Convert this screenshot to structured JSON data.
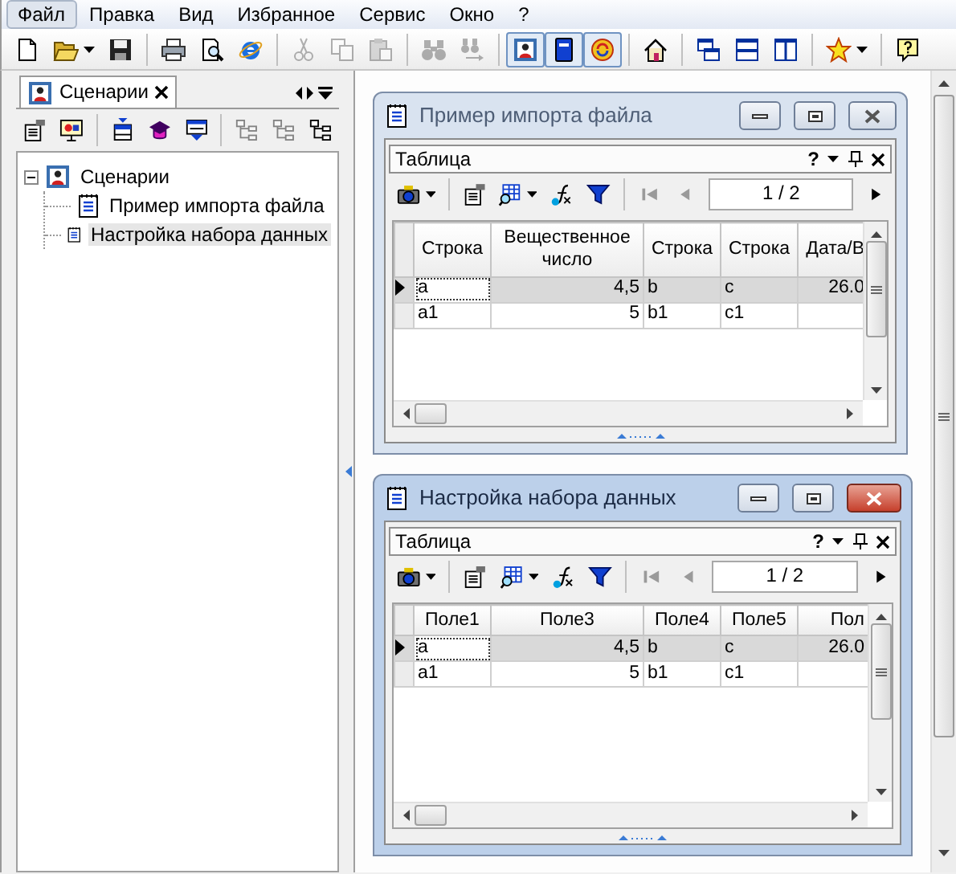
{
  "menu": [
    {
      "label": "Файл",
      "selected": true
    },
    {
      "label": "Правка",
      "selected": false
    },
    {
      "label": "Вид",
      "selected": false
    },
    {
      "label": "Избранное",
      "selected": false
    },
    {
      "label": "Сервис",
      "selected": false
    },
    {
      "label": "Окно",
      "selected": false
    },
    {
      "label": "?",
      "selected": false
    }
  ],
  "toolbar": {
    "groups": [
      {
        "buttons": [
          {
            "pressed": false,
            "disabled": false
          },
          {
            "pressed": false,
            "disabled": false,
            "dropdown": true
          },
          {
            "pressed": false,
            "disabled": false
          }
        ]
      },
      {
        "buttons": [
          {
            "pressed": false,
            "disabled": false
          },
          {
            "pressed": false,
            "disabled": false
          },
          {
            "pressed": false,
            "disabled": false
          }
        ]
      },
      {
        "buttons": [
          {
            "pressed": false,
            "disabled": true
          },
          {
            "pressed": false,
            "disabled": true
          },
          {
            "pressed": false,
            "disabled": true
          }
        ]
      },
      {
        "buttons": [
          {
            "pressed": false,
            "disabled": true
          },
          {
            "pressed": false,
            "disabled": true
          }
        ]
      },
      {
        "buttons": [
          {
            "pressed": true,
            "disabled": false
          },
          {
            "pressed": true,
            "disabled": false
          },
          {
            "pressed": true,
            "disabled": false
          }
        ]
      },
      {
        "buttons": [
          {
            "pressed": false,
            "disabled": false
          }
        ]
      },
      {
        "buttons": [
          {
            "pressed": false,
            "disabled": false
          },
          {
            "pressed": false,
            "disabled": false
          },
          {
            "pressed": false,
            "disabled": false
          }
        ]
      },
      {
        "buttons": [
          {
            "pressed": false,
            "disabled": false,
            "dropdown": true
          }
        ]
      },
      {
        "buttons": [
          {
            "pressed": false,
            "disabled": false
          }
        ]
      }
    ]
  },
  "side_panel": {
    "tab": {
      "label": "Сценарии",
      "selected": true
    },
    "toolbar": {
      "groups": [
        {
          "buttons": [
            {
              "disabled": false
            },
            {
              "disabled": false
            }
          ]
        },
        {
          "buttons": [
            {
              "disabled": false
            },
            {
              "disabled": false
            },
            {
              "disabled": false
            }
          ]
        },
        {
          "buttons": [
            {
              "disabled": true
            },
            {
              "disabled": true
            },
            {
              "disabled": false
            }
          ]
        }
      ]
    },
    "tree": [
      {
        "label": "Сценарии",
        "expanded": true,
        "selected": false,
        "children": [
          {
            "label": "Пример импорта файла",
            "selected": false
          },
          {
            "label": "Настройка набора данных",
            "selected": true
          }
        ]
      }
    ]
  },
  "windows": [
    {
      "title": "Пример импорта файла",
      "active": false,
      "panel": {
        "title": "Таблица",
        "help": "?"
      },
      "toolbar": {
        "groups": [
          {
            "buttons": [
              {
                "disabled": false,
                "dropdown": true
              }
            ]
          },
          {
            "buttons": [
              {
                "disabled": false
              },
              {
                "disabled": false,
                "dropdown": true
              },
              {
                "disabled": false
              },
              {
                "disabled": false
              }
            ]
          }
        ]
      },
      "pager": {
        "page": "1 / 2",
        "buttons": [
          {
            "disabled": true
          },
          {
            "disabled": true
          },
          {
            "disabled": false
          }
        ]
      },
      "columns": [
        {
          "label": "Строка",
          "kind": "text"
        },
        {
          "label": "Вещественное число",
          "kind": "number"
        },
        {
          "label": "Строка",
          "kind": "text"
        },
        {
          "label": "Строка",
          "kind": "text"
        },
        {
          "label": "Дата/В",
          "kind": "number"
        }
      ],
      "rows": [
        {
          "current": true,
          "selected": true,
          "cells": [
            {
              "text": "a",
              "focused": true
            },
            {
              "text": "4,5",
              "focused": false
            },
            {
              "text": "b",
              "focused": false
            },
            {
              "text": "c",
              "focused": false
            },
            {
              "text": "26.0",
              "focused": false
            }
          ]
        },
        {
          "current": false,
          "selected": false,
          "cells": [
            {
              "text": "a1",
              "focused": false
            },
            {
              "text": "5",
              "focused": false
            },
            {
              "text": "b1",
              "focused": false
            },
            {
              "text": "c1",
              "focused": false
            }
          ]
        }
      ]
    },
    {
      "title": "Настройка набора данных",
      "active": true,
      "panel": {
        "title": "Таблица",
        "help": "?"
      },
      "toolbar": {
        "groups": [
          {
            "buttons": [
              {
                "disabled": false,
                "dropdown": true
              }
            ]
          },
          {
            "buttons": [
              {
                "disabled": false
              },
              {
                "disabled": false,
                "dropdown": true
              },
              {
                "disabled": false
              },
              {
                "disabled": false
              }
            ]
          }
        ]
      },
      "pager": {
        "page": "1 / 2",
        "buttons": [
          {
            "disabled": true
          },
          {
            "disabled": true
          },
          {
            "disabled": false
          }
        ]
      },
      "columns": [
        {
          "label": "Поле1",
          "kind": "text"
        },
        {
          "label": "Поле3",
          "kind": "number"
        },
        {
          "label": "Поле4",
          "kind": "text"
        },
        {
          "label": "Поле5",
          "kind": "text"
        },
        {
          "label": "Пол",
          "kind": "number"
        }
      ],
      "rows": [
        {
          "current": true,
          "selected": true,
          "cells": [
            {
              "text": "a",
              "focused": true
            },
            {
              "text": "4,5",
              "focused": false
            },
            {
              "text": "b",
              "focused": false
            },
            {
              "text": "c",
              "focused": false
            },
            {
              "text": "26.0",
              "focused": false
            }
          ]
        },
        {
          "current": false,
          "selected": false,
          "cells": [
            {
              "text": "a1",
              "focused": false
            },
            {
              "text": "5",
              "focused": false
            },
            {
              "text": "b1",
              "focused": false
            },
            {
              "text": "c1",
              "focused": false
            }
          ]
        }
      ]
    }
  ]
}
